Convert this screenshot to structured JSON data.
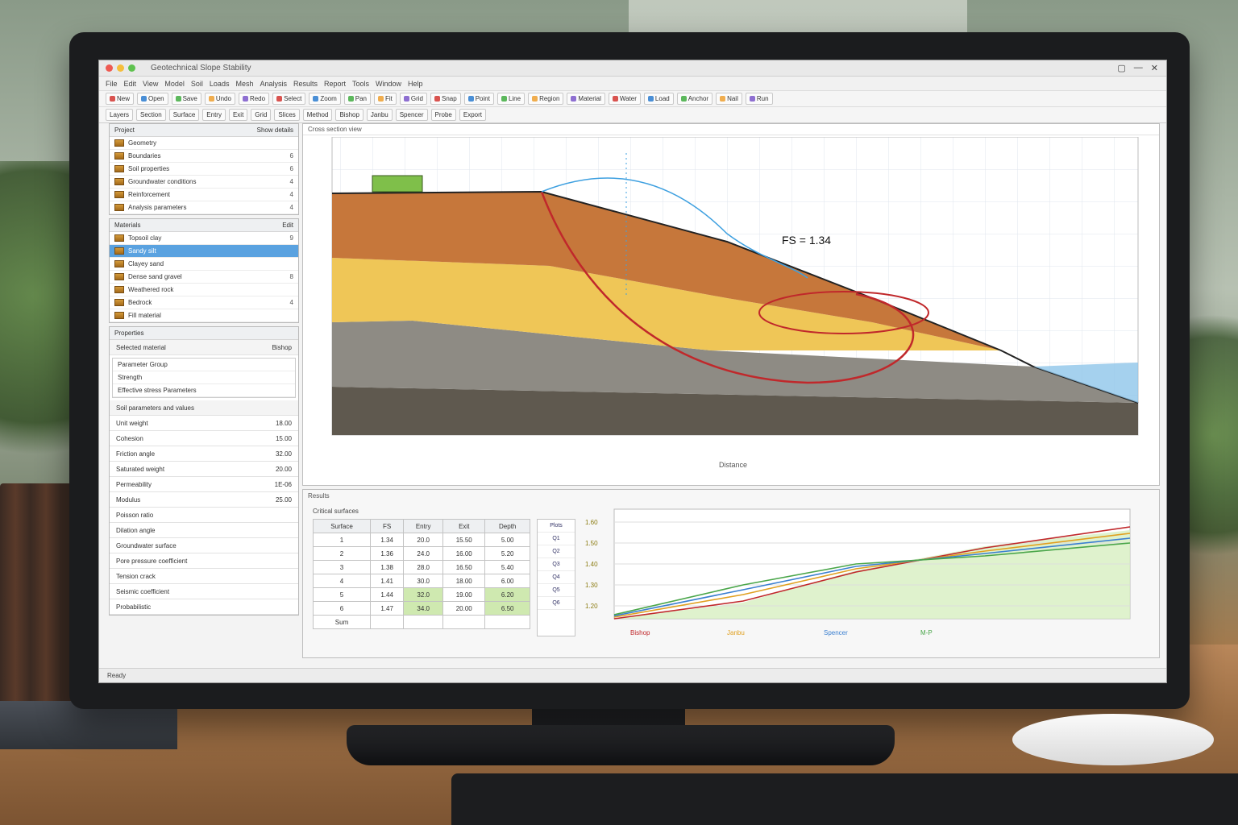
{
  "window": {
    "title": "Geotechnical Slope Stability"
  },
  "menu": [
    "File",
    "Edit",
    "View",
    "Model",
    "Soil",
    "Loads",
    "Mesh",
    "Analysis",
    "Results",
    "Report",
    "Tools",
    "Window",
    "Help"
  ],
  "toolbar": [
    "New",
    "Open",
    "Save",
    "Undo",
    "Redo",
    "Select",
    "Zoom",
    "Pan",
    "Fit",
    "Grid",
    "Snap",
    "Point",
    "Line",
    "Region",
    "Material",
    "Water",
    "Load",
    "Anchor",
    "Nail",
    "Run"
  ],
  "toolbar2": [
    "Layers",
    "Section",
    "Surface",
    "Entry",
    "Exit",
    "Grid",
    "Slices",
    "Method",
    "Bishop",
    "Janbu",
    "Spencer",
    "Probe",
    "Export"
  ],
  "left": {
    "project_title": "Project",
    "project_action": "Show details",
    "project_items": [
      {
        "label": "Geometry",
        "val": ""
      },
      {
        "label": "Boundaries",
        "val": "6"
      },
      {
        "label": "Soil properties",
        "val": "6"
      },
      {
        "label": "Groundwater conditions",
        "val": "4"
      },
      {
        "label": "Reinforcement",
        "val": "4"
      },
      {
        "label": "Analysis parameters",
        "val": "4"
      }
    ],
    "materials_title": "Materials",
    "materials_action": "Edit",
    "material_items": [
      {
        "label": "Topsoil clay",
        "val": "9"
      },
      {
        "label": "Sandy silt",
        "val": ""
      },
      {
        "label": "Clayey sand",
        "val": ""
      },
      {
        "label": "Dense sand gravel",
        "val": "8"
      },
      {
        "label": "Weathered rock",
        "val": ""
      },
      {
        "label": "Bedrock",
        "val": "4"
      },
      {
        "label": "Fill material",
        "val": ""
      }
    ],
    "props_title": "Properties",
    "props_sub": "Selected material",
    "props_sub_val": "Bishop",
    "props_notes": [
      "Parameter Group",
      "Strength",
      "Effective stress Parameters"
    ],
    "props_head": "Soil parameters and values",
    "props_rows": [
      {
        "label": "Unit weight",
        "val": "18.00"
      },
      {
        "label": "Cohesion",
        "val": "15.00"
      },
      {
        "label": "Friction angle",
        "val": "32.00"
      },
      {
        "label": "Saturated weight",
        "val": "20.00"
      },
      {
        "label": "Permeability",
        "val": "1E-06"
      },
      {
        "label": "Modulus",
        "val": "25.00"
      },
      {
        "label": "Poisson ratio",
        "val": ""
      },
      {
        "label": "Dilation angle",
        "val": ""
      },
      {
        "label": "Groundwater surface",
        "val": ""
      },
      {
        "label": "Pore pressure coefficient",
        "val": ""
      },
      {
        "label": "Tension crack",
        "val": ""
      },
      {
        "label": "Seismic coefficient",
        "val": ""
      },
      {
        "label": "Probabilistic",
        "val": ""
      }
    ]
  },
  "canvas": {
    "title": "Cross section view",
    "fs_label": "FS = 1.34",
    "x_axis_label": "Distance"
  },
  "bottom": {
    "title": "Results",
    "table_title": "Critical surfaces",
    "table_head": [
      "Surface",
      "FS",
      "Entry",
      "Exit",
      "Depth"
    ],
    "table_rows": [
      [
        "1",
        "1.34",
        "20.0",
        "15.50",
        "5.00"
      ],
      [
        "2",
        "1.36",
        "24.0",
        "16.00",
        "5.20"
      ],
      [
        "3",
        "1.38",
        "28.0",
        "16.50",
        "5.40"
      ],
      [
        "4",
        "1.41",
        "30.0",
        "18.00",
        "6.00"
      ],
      [
        "5",
        "1.44",
        "32.0",
        "19.00",
        "6.20"
      ],
      [
        "6",
        "1.47",
        "34.0",
        "20.00",
        "6.50"
      ],
      [
        "Sum",
        "",
        "",
        "",
        ""
      ]
    ],
    "mini_head": "Plots",
    "mini_items": [
      "Q1",
      "Q2",
      "Q3",
      "Q4",
      "Q5",
      "Q6"
    ],
    "plot_y_ticks": [
      "1.60",
      "1.50",
      "1.40",
      "1.30",
      "1.20"
    ],
    "plot_legend": [
      "Bishop",
      "Janbu",
      "Spencer",
      "M-P"
    ]
  },
  "status": {
    "text": "Ready"
  },
  "colors": {
    "topsoil": "#c97a3e",
    "sand": "#f0c85a",
    "clay": "#8a8a86",
    "rock": "#6b6458",
    "slip": "#c0282b",
    "water": "#3ea0e0"
  }
}
